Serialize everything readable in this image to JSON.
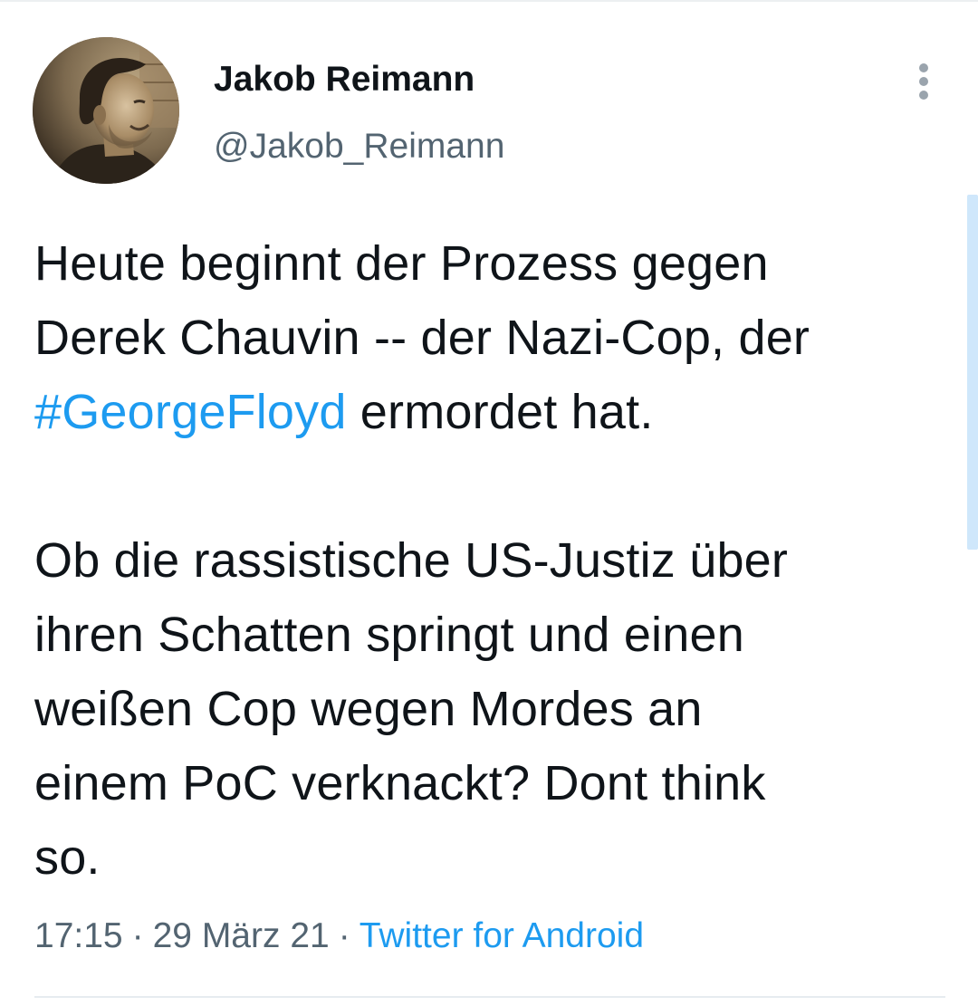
{
  "author": {
    "display_name": "Jakob Reimann",
    "handle": "@Jakob_Reimann",
    "avatar_icon": "profile-photo"
  },
  "menu": {
    "icon": "more-vertical-icon"
  },
  "tweet": {
    "text_line_1": "Heute beginnt der Prozess gegen",
    "text_line_2": "Derek Chauvin -- der Nazi-Cop, der",
    "hashtag": "#GeorgeFloyd",
    "text_line_3_rest": " ermordet hat.",
    "paragraph_2_line_1": "Ob die rassistische US-Justiz über",
    "paragraph_2_line_2": "ihren Schatten springt und einen",
    "paragraph_2_line_3": "weißen Cop wegen Mordes an",
    "paragraph_2_line_4": "einem PoC verknackt? Dont think",
    "paragraph_2_line_5": "so."
  },
  "meta": {
    "time": "17:15",
    "separator": "·",
    "date": "29 März 21",
    "source": "Twitter for Android"
  },
  "colors": {
    "link": "#1d9bf0",
    "text": "#0f1419",
    "secondary_text": "#536471"
  }
}
